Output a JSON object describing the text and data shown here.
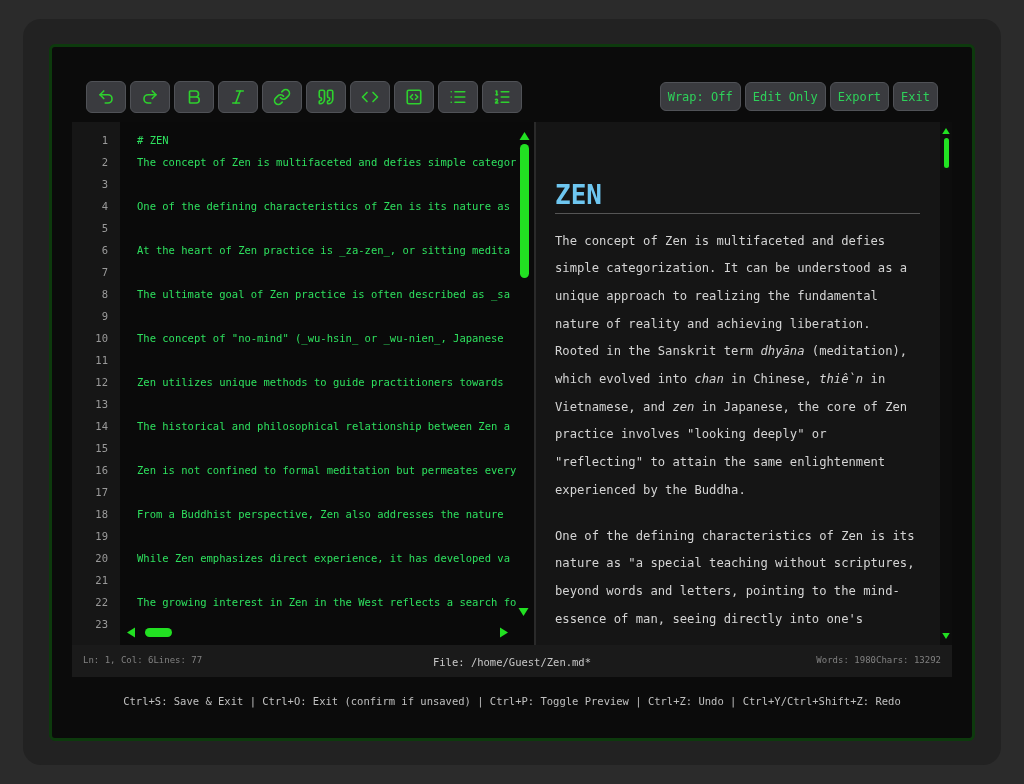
{
  "toolbar": {
    "buttons": [
      {
        "label": "Wrap: Off"
      },
      {
        "label": "Edit Only"
      },
      {
        "label": "Export"
      },
      {
        "label": "Exit"
      }
    ]
  },
  "editor": {
    "lines": [
      {
        "number": "1",
        "text": "# ZEN"
      },
      {
        "number": "2",
        "text": "The concept of Zen is multifaceted and defies simple categor"
      },
      {
        "number": "3"
      },
      {
        "number": "4",
        "text": "One of the defining characteristics of Zen is its nature as"
      },
      {
        "number": "5"
      },
      {
        "number": "6",
        "text": "At the heart of Zen practice is _za-zen_, or sitting medita"
      },
      {
        "number": "7"
      },
      {
        "number": "8",
        "text": "The ultimate goal of Zen practice is often described as _sa"
      },
      {
        "number": "9"
      },
      {
        "number": "10",
        "text": "The concept of \"no-mind\" (_wu-hsin_ or _wu-nien_, Japanese"
      },
      {
        "number": "11"
      },
      {
        "number": "12",
        "text": "Zen utilizes unique methods to guide practitioners towards"
      },
      {
        "number": "13"
      },
      {
        "number": "14",
        "text": "The historical and philosophical relationship between Zen a"
      },
      {
        "number": "15"
      },
      {
        "number": "16",
        "text": "Zen is not confined to formal meditation but permeates every"
      },
      {
        "number": "17"
      },
      {
        "number": "18",
        "text": "From a Buddhist perspective, Zen also addresses the nature"
      },
      {
        "number": "19"
      },
      {
        "number": "20",
        "text": "While Zen emphasizes direct experience, it has developed va"
      },
      {
        "number": "21"
      },
      {
        "number": "22",
        "text": "The growing interest in Zen in the West reflects a search fo"
      },
      {
        "number": "23"
      }
    ]
  },
  "preview": {
    "heading": "ZEN",
    "paragraphs": [
      "The concept of Zen is multifaceted and defies simple categorization. It can be understood as a unique approach to realizing the fundamental nature of reality and achieving liberation. Rooted in the Sanskrit term *dhyāna* (meditation), which evolved into *chan* in Chinese, *thiền* in Vietnamese, and *zen* in Japanese, the core of Zen practice involves \"looking deeply\" or \"reflecting\" to attain the same enlightenment experienced by the Buddha.",
      "One of the defining characteristics of Zen is its nature as \"a special teaching without scriptures, beyond words and letters, pointing to the mind-essence of man, seeing directly into one's"
    ]
  },
  "status_bar": {
    "position": "Ln: 1, Col: 6Lines: 77",
    "file": "File: /home/Guest/Zen.md*",
    "counts": "Words: 1980Chars: 13292"
  },
  "shortcuts": "Ctrl+S: Save & Exit | Ctrl+O: Exit (confirm if unsaved) | Ctrl+P: Toggle Preview | Ctrl+Z: Undo | Ctrl+Y/Ctrl+Shift+Z: Redo"
}
